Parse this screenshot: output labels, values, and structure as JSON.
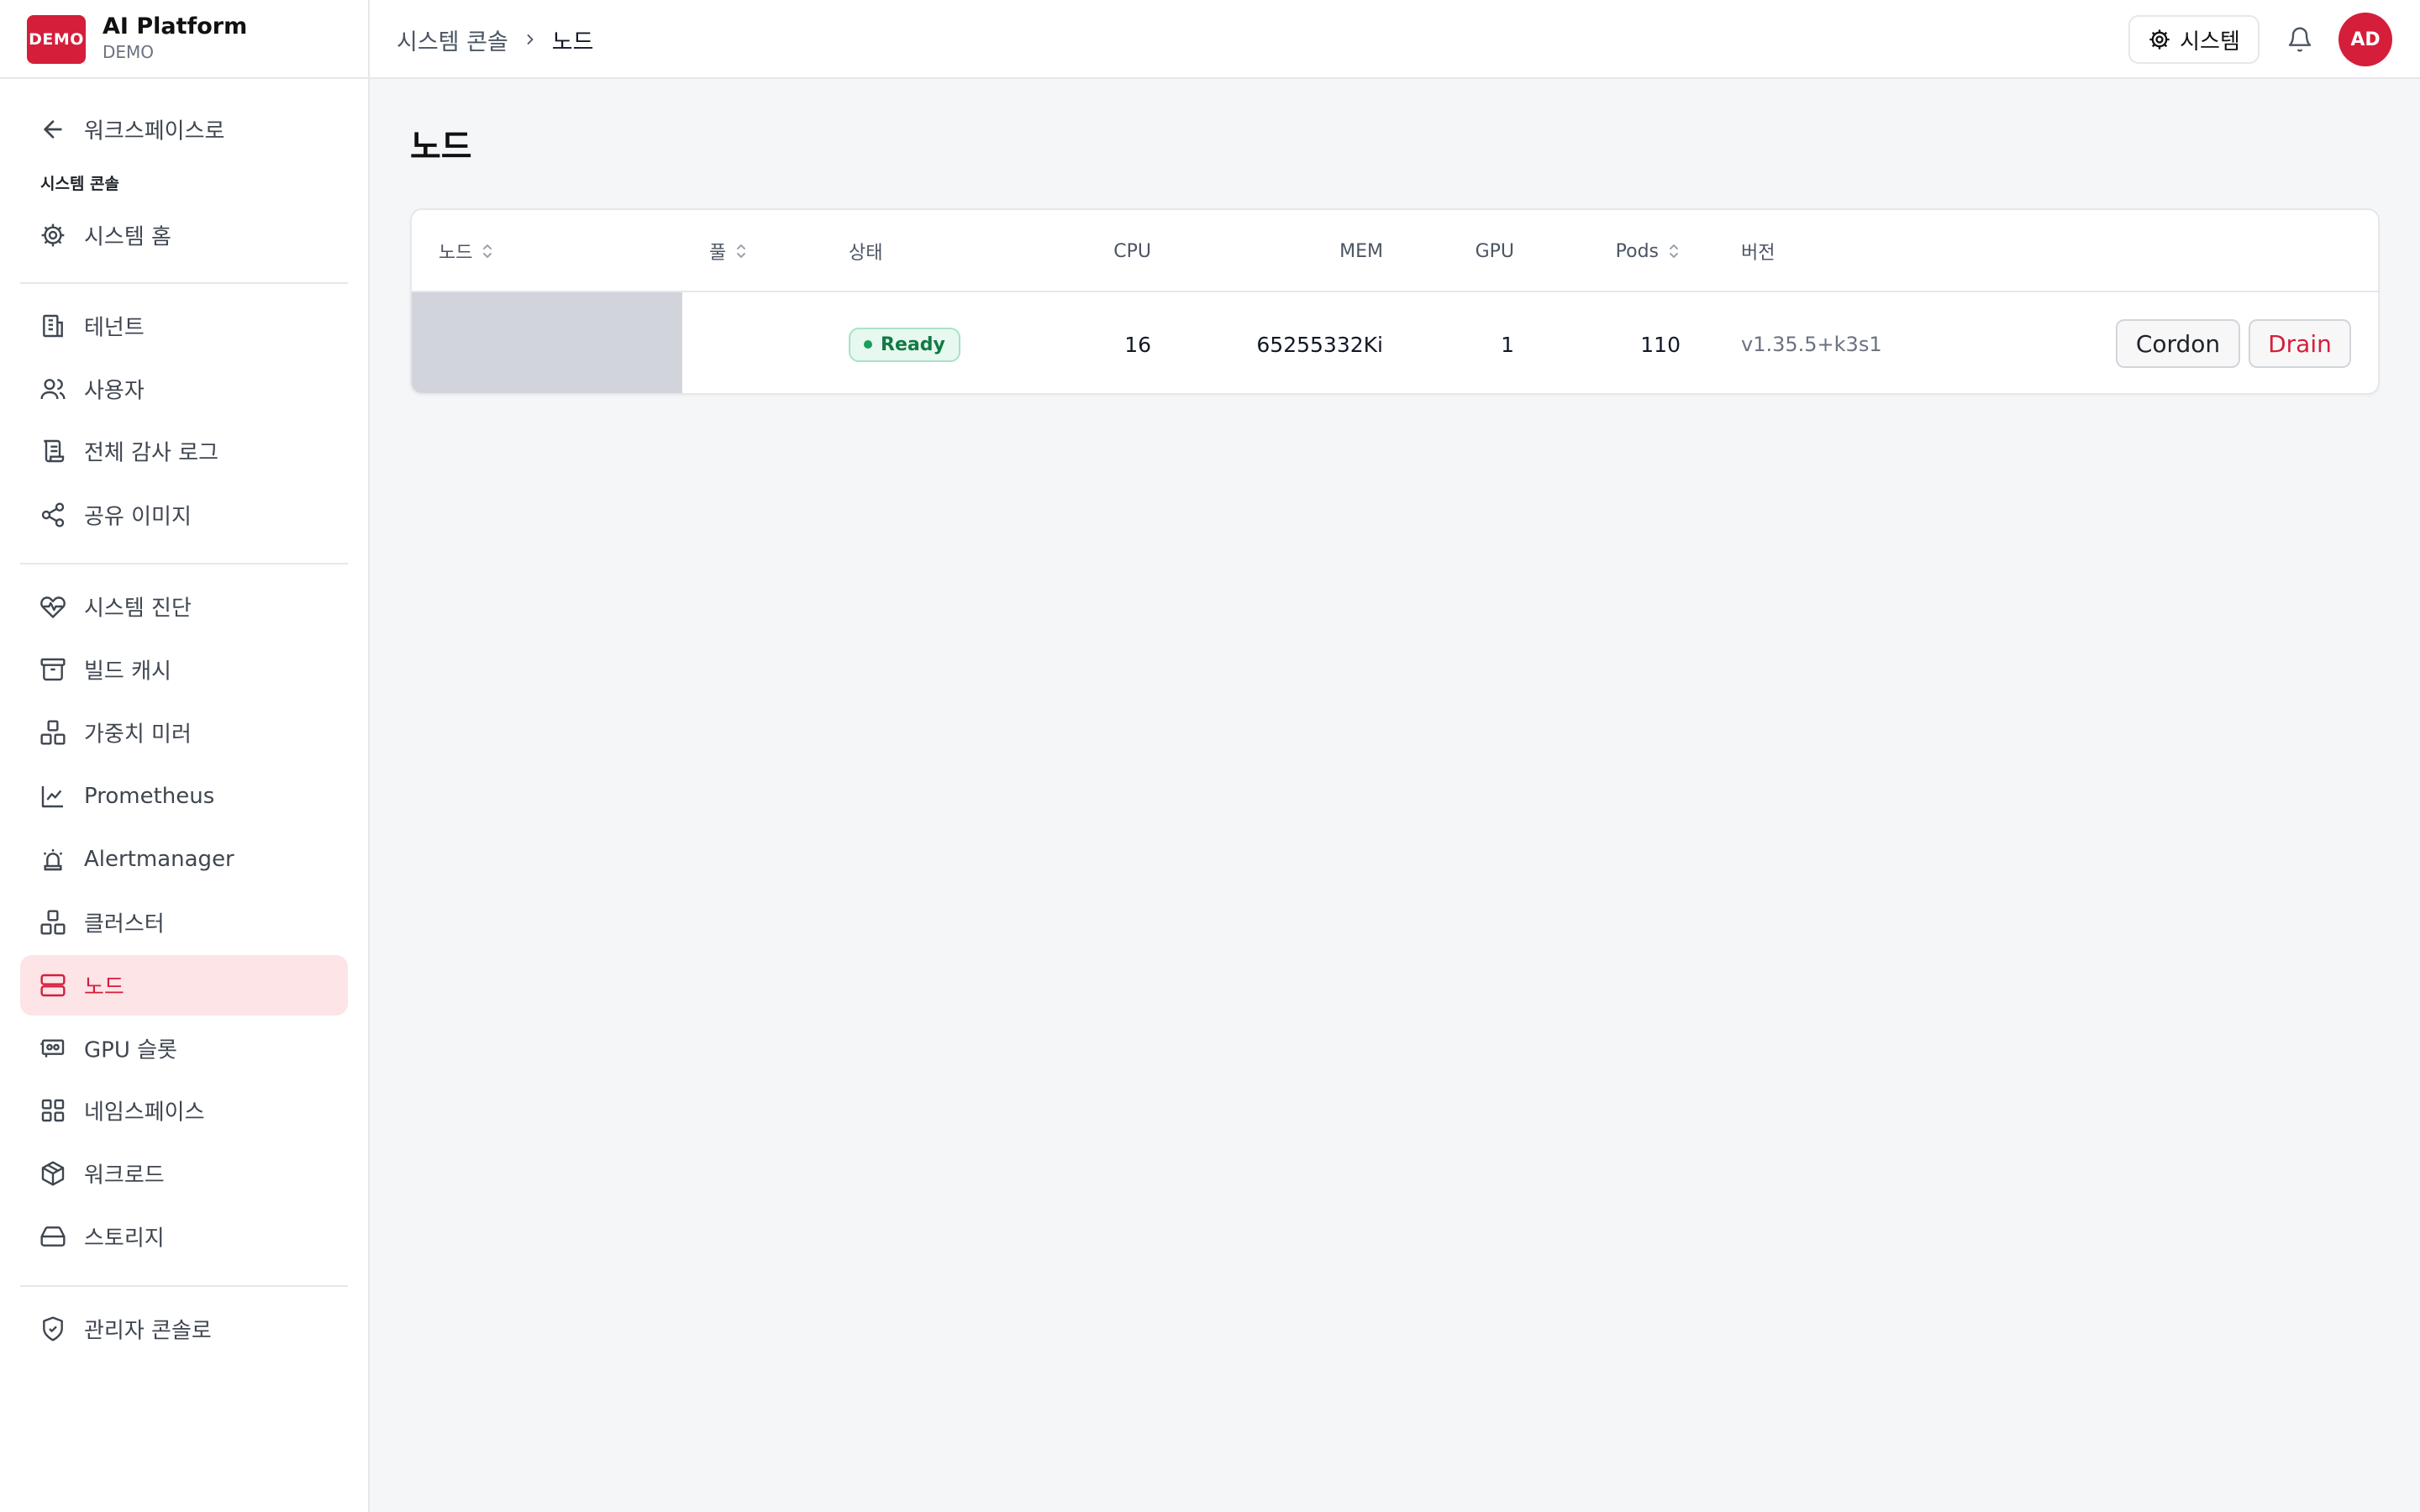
{
  "brand": {
    "logo_text": "DEMO",
    "title": "AI Platform",
    "subtitle": "DEMO",
    "accent_color": "#d41e3a"
  },
  "sidebar": {
    "back_label": "워크스페이스로",
    "section_label": "시스템 콘솔",
    "home": {
      "label": "시스템 홈",
      "icon": "gear-icon"
    },
    "group1": [
      {
        "label": "테넌트",
        "icon": "building-icon"
      },
      {
        "label": "사용자",
        "icon": "users-icon"
      },
      {
        "label": "전체 감사 로그",
        "icon": "scroll-icon"
      },
      {
        "label": "공유 이미지",
        "icon": "share-icon"
      }
    ],
    "group2": [
      {
        "label": "시스템 진단",
        "icon": "heart-pulse-icon"
      },
      {
        "label": "빌드 캐시",
        "icon": "archive-icon"
      },
      {
        "label": "가중치 미러",
        "icon": "boxes-icon"
      },
      {
        "label": "Prometheus",
        "icon": "line-chart-icon"
      },
      {
        "label": "Alertmanager",
        "icon": "siren-icon"
      },
      {
        "label": "클러스터",
        "icon": "cluster-icon"
      },
      {
        "label": "노드",
        "icon": "server-icon",
        "active": true
      },
      {
        "label": "GPU 슬롯",
        "icon": "gpu-icon"
      },
      {
        "label": "네임스페이스",
        "icon": "grid-icon"
      },
      {
        "label": "워크로드",
        "icon": "package-icon"
      },
      {
        "label": "스토리지",
        "icon": "hard-drive-icon"
      }
    ],
    "admin": {
      "label": "관리자 콘솔로",
      "icon": "shield-check-icon"
    }
  },
  "header": {
    "breadcrumb_parent": "시스템 콘솔",
    "breadcrumb_current": "노드",
    "system_button": "시스템",
    "avatar_initials": "AD"
  },
  "page": {
    "title": "노드"
  },
  "table": {
    "columns": {
      "node": "노드",
      "pool": "풀",
      "status": "상태",
      "cpu": "CPU",
      "mem": "MEM",
      "gpu": "GPU",
      "pods": "Pods",
      "version": "버전"
    },
    "rows": [
      {
        "node": "",
        "pool": "",
        "status": "Ready",
        "cpu": "16",
        "mem": "65255332Ki",
        "gpu": "1",
        "pods": "110",
        "version": "v1.35.5+k3s1",
        "cordon_label": "Cordon",
        "drain_label": "Drain"
      }
    ]
  }
}
